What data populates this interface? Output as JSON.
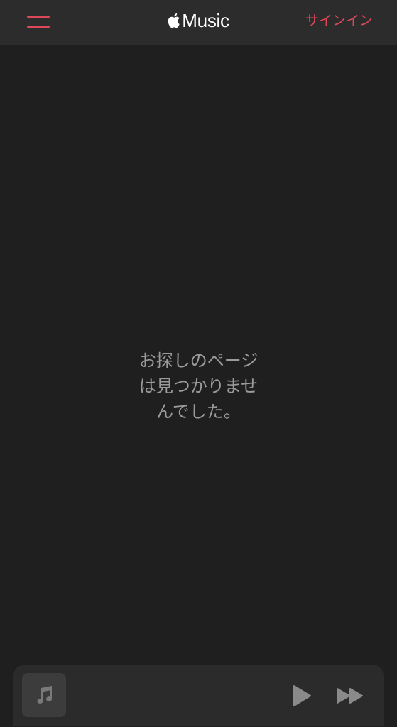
{
  "header": {
    "menu_icon": "hamburger-menu-icon",
    "logo_icon": "apple-logo-icon",
    "logo_text": "Music",
    "signin_label": "サインイン",
    "accent_color": "#e0485a"
  },
  "main": {
    "message_lines": [
      "お探しのページ",
      "は見つかりませ",
      "んでした。"
    ]
  },
  "player": {
    "artwork_icon": "music-note-icon",
    "play_icon": "play-icon",
    "next_icon": "fast-forward-icon"
  }
}
